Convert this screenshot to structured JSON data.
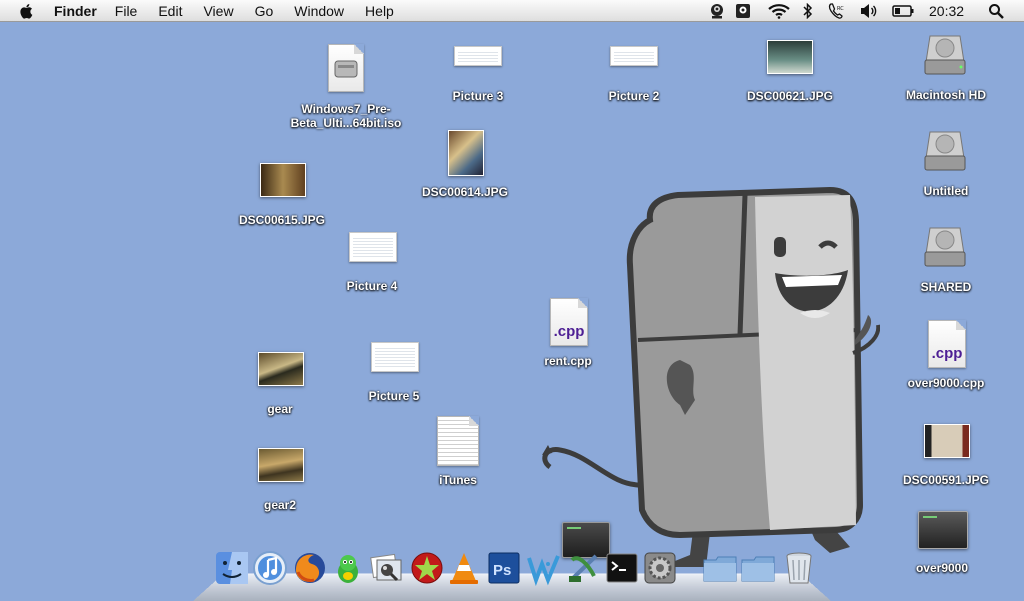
{
  "menubar": {
    "app_name": "Finder",
    "menus": [
      "File",
      "Edit",
      "View",
      "Go",
      "Window",
      "Help"
    ],
    "extras": [
      "camera-icon",
      "webcam-icon",
      "wifi-icon",
      "bluetooth-icon",
      "phone-icon",
      "volume-icon",
      "battery-icon"
    ],
    "clock": "20:32"
  },
  "desktop": {
    "windows_iso": "Windows7_Pre-",
    "windows_iso_line2": "Beta_Ulti...64bit.iso",
    "picture3": "Picture 3",
    "picture2": "Picture 2",
    "dsc00621": "DSC00621.JPG",
    "macintosh_hd": "Macintosh HD",
    "dsc00614": "DSC00614.JPG",
    "untitled": "Untitled",
    "dsc00615": "DSC00615.JPG",
    "picture4": "Picture 4",
    "shared": "SHARED",
    "rent_cpp": "rent.cpp",
    "over9000_cpp": "over9000.cpp",
    "gear": "gear",
    "picture5": "Picture 5",
    "itunes": "iTunes",
    "dsc00591": "DSC00591.JPG",
    "gear2": "gear2",
    "over9000": "over9000",
    "cpp_badge": ".cpp"
  },
  "dock": {
    "items": [
      "finder-icon",
      "itunes-icon",
      "firefox-icon",
      "adium-icon",
      "preview-icon",
      "red-app-icon",
      "vlc-icon",
      "photoshop-icon",
      "dreamweaver-icon",
      "xcode-icon",
      "terminal-icon",
      "system-preferences-icon",
      "folder-icon",
      "documents-folder-icon",
      "trash-icon"
    ]
  },
  "colors": {
    "desktop": "#8ca9d9",
    "fridge_gray": "#9c9c9c"
  }
}
